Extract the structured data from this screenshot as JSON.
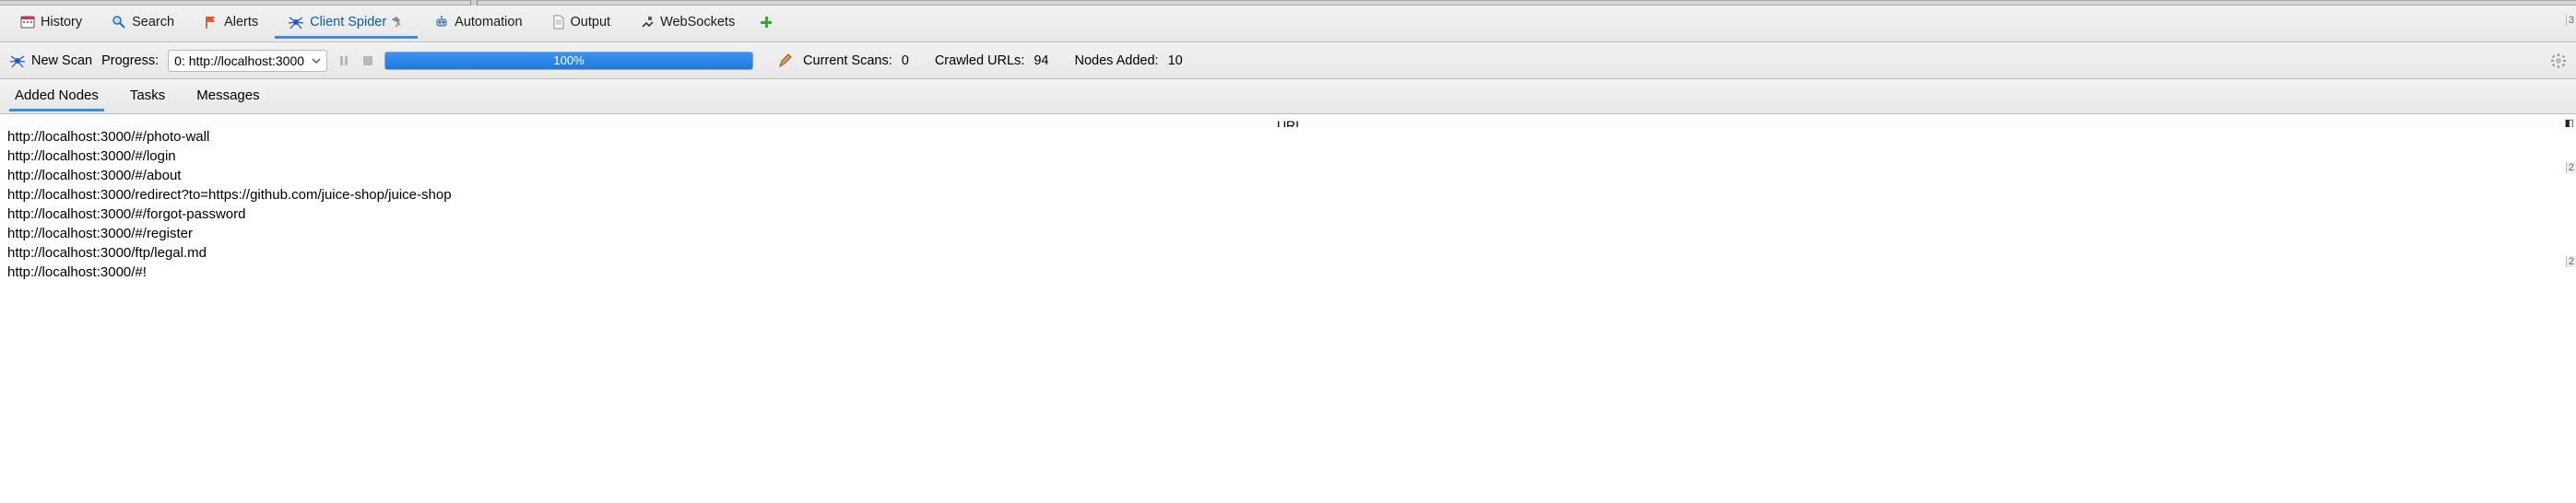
{
  "tabs": {
    "history": "History",
    "search": "Search",
    "alerts": "Alerts",
    "client_spider": "Client Spider",
    "automation": "Automation",
    "output": "Output",
    "websockets": "WebSockets"
  },
  "scanbar": {
    "new_scan": "New Scan",
    "progress_label": "Progress:",
    "select_value": "0: http://localhost:3000",
    "progress_percent": "100%",
    "current_scans_label": "Current Scans:",
    "current_scans_value": "0",
    "crawled_label": "Crawled URLs:",
    "crawled_value": "94",
    "nodes_added_label": "Nodes Added:",
    "nodes_added_value": "10"
  },
  "subtabs": {
    "added_nodes": "Added Nodes",
    "tasks": "Tasks",
    "messages": "Messages"
  },
  "table": {
    "header": "URI",
    "rows": [
      "http://localhost:3000/#/photo-wall",
      "http://localhost:3000/#/login",
      "http://localhost:3000/#/about",
      "http://localhost:3000/redirect?to=https://github.com/juice-shop/juice-shop",
      "http://localhost:3000/#/forgot-password",
      "http://localhost:3000/#/register",
      "http://localhost:3000/ftp/legal.md",
      "http://localhost:3000/#!"
    ]
  },
  "side_ticks": {
    "t1": "3",
    "t2": "2",
    "t3": "2"
  }
}
